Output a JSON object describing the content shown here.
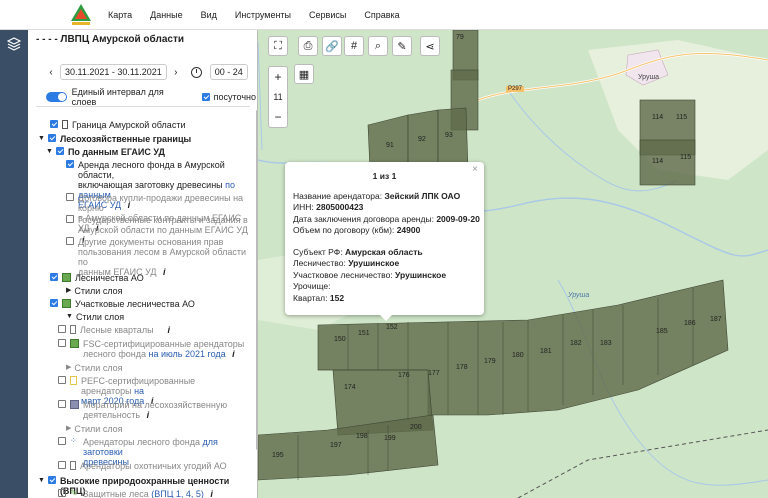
{
  "menu": [
    "Карта",
    "Данные",
    "Вид",
    "Инструменты",
    "Сервисы",
    "Справка"
  ],
  "panel": {
    "title": "- - - - ЛВПЦ Амурской области",
    "date_from_to": "30.11.2021  -  30.11.2021",
    "time_range": "00  -  24",
    "single_interval_label": "Единый интервал для слоев",
    "hourly_label": "посуточно"
  },
  "tree": {
    "amur_border": "Граница Амурской области",
    "forest_bounds": "Лесохозяйственные границы",
    "egais": "По данным ЕГАИС УД",
    "lease_a": "Аренда лесного фонда в Амурской области,",
    "lease_b": "включающая заготовку древесины",
    "lease_c": "по данным",
    "lease_d": "ЕГАИС УД",
    "buy_a": "Договора купли-продажи древесины на корню",
    "buy_b": "в Амурской области",
    "buy_c": "по данным ЕГАИС УД",
    "gov_a": "Государственные контракты и задания в",
    "gov_b": "Амурской области",
    "gov_c": "по данным ЕГАИС УД",
    "other_a": "Другие документы основания прав",
    "other_b": "пользования лесом в Амурской области",
    "other_c": "по",
    "other_d": "данным ЕГАИС УД",
    "forestries": "Лесничества АО",
    "styles": "Стили слоя",
    "district_forestries": "Участковые лесничества АО",
    "styles2": "Стили слоя",
    "quarters": "Лесные кварталы",
    "fsc_a": "FSC-сертифицированные арендаторы",
    "fsc_b": "лесного фонда",
    "fsc_c": "на июль 2021 года",
    "styles3": "Стили слоя",
    "pefc_a": "PEFC-сертифицированные арендаторы",
    "pefc_b": "на",
    "pefc_c": "март 2020 года",
    "moratoria_a": "Мораторий на лесохозяйственную",
    "moratoria_b": "деятельность",
    "styles4": "Стили слоя",
    "lessees_a": "Арендаторы лесного фонда",
    "lessees_b": "для заготовки",
    "lessees_c": "древесины",
    "hunting": "Арендаторы охотничьих угодий АО",
    "hcv": "Высокие природоохранные ценности (ВПЦ)",
    "protective_a": "Защитные леса",
    "protective_b": "(ВПЦ 1, 4, 5)",
    "info": "i"
  },
  "map": {
    "zoom_level": "11",
    "popup": {
      "count": "1 из 1",
      "close": "×",
      "tenant_label": "Название арендатора:",
      "tenant": "Зейский ЛПК ОАО",
      "inn_label": "ИНН:",
      "inn": "2805000423",
      "date_label": "Дата заключения договора аренды:",
      "date": "2009-09-20",
      "volume_label": "Объем по договору (кбм):",
      "volume": "24900",
      "subject_label": "Субъект РФ:",
      "subject": "Амурская область",
      "forestry_label": "Лесничество:",
      "forestry": "Урушинское",
      "district_label": "Участковое лесничество:",
      "district": "Урушинское",
      "tract_label": "Урочище:",
      "quarter_label": "Квартал:",
      "quarter": "152"
    },
    "places": {
      "urusha_town": "Уруша",
      "urusha_river": "Уруша",
      "road": "Р297"
    },
    "quarters": [
      "79",
      "91",
      "92",
      "93",
      "114",
      "115",
      "114",
      "115",
      "150",
      "151",
      "152",
      "174",
      "176",
      "177",
      "178",
      "179",
      "180",
      "181",
      "182",
      "183",
      "185",
      "186",
      "187",
      "195",
      "197",
      "198",
      "199",
      "200"
    ]
  },
  "colors": {
    "accent": "#2c7be5",
    "sidebar": "#3a4f66",
    "map_bg": "#cfe5c8",
    "quarter_fill": "#5f6b4a"
  }
}
